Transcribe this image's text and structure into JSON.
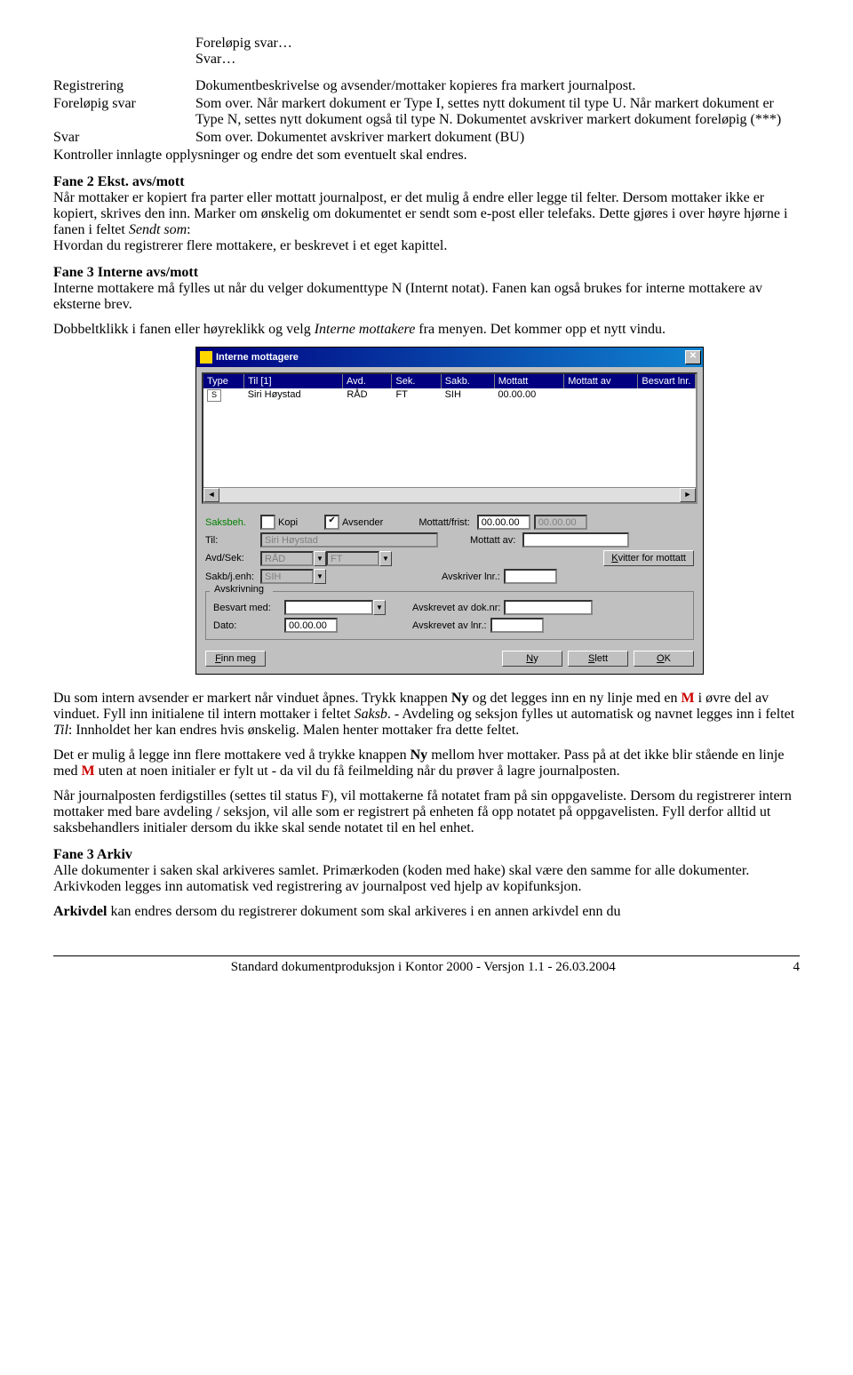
{
  "intro_items": [
    "Foreløpig svar…",
    "Svar…"
  ],
  "defs": [
    {
      "term": "Registrering",
      "desc": "Dokumentbeskrivelse og avsender/mottaker kopieres fra markert journalpost."
    },
    {
      "term": "Foreløpig svar",
      "desc": "Som over. Når markert dokument er Type I, settes nytt dokument til type U. Når markert dokument er Type N, settes nytt dokument også til type N. Dokumentet avskriver markert dokument foreløpig (***)"
    },
    {
      "term": "Svar",
      "desc": "Som over. Dokumentet avskriver markert dokument (BU)"
    }
  ],
  "para1": "Kontroller innlagte opplysninger og endre det som eventuelt skal endres.",
  "fane2": {
    "heading": "Fane 2 Ekst. avs/mott",
    "body_a": "Når mottaker er kopiert fra parter eller mottatt journalpost, er det mulig å endre eller legge til felter. Dersom mottaker ikke er kopiert, skrives den inn. Marker om ønskelig om dokumentet er sendt som e-post eller telefaks. Dette gjøres i over høyre hjørne i fanen i feltet ",
    "body_italic": "Sendt som",
    "body_b": ":",
    "body_c": "Hvordan du registrerer flere mottakere, er beskrevet i et eget kapittel."
  },
  "fane3int": {
    "heading": "Fane 3 Interne avs/mott",
    "line1": "Interne mottakere må fylles ut når du velger dokumenttype N (Internt notat). Fanen kan også brukes for interne mottakere av eksterne brev.",
    "line2a": "Dobbeltklikk i fanen eller høyreklikk og velg ",
    "line2_italic": "Interne mottakere",
    "line2b": " fra menyen. Det kommer opp et nytt vindu."
  },
  "dialog": {
    "title": "Interne mottagere",
    "headers": {
      "type": "Type",
      "til": "Til [1]",
      "avd": "Avd.",
      "sek": "Sek.",
      "sakb": "Sakb.",
      "mottatt": "Mottatt",
      "mottattav": "Mottatt av",
      "besvart": "Besvart lnr."
    },
    "row": {
      "type": "S",
      "til": "Siri Høystad",
      "avd": "RÅD",
      "sek": "FT",
      "sakb": "SIH",
      "mottatt": "00.00.00",
      "mottattav": "",
      "besvart": ""
    },
    "form": {
      "saksbeh": "Saksbeh.",
      "kopi": "Kopi",
      "avsender": "Avsender",
      "mottatt_frist": "Mottatt/frist:",
      "til": "Til:",
      "til_val": "Siri Høystad",
      "mottatt_av": "Mottatt av:",
      "avdsek": "Avd/Sek:",
      "avd_val": "RÅD",
      "sek_val": "FT",
      "kvitter": "Kvitter for mottatt",
      "sakbj": "Sakb/j.enh:",
      "sakbj_val": "SIH",
      "avskriverlnr": "Avskriver lnr.:",
      "group": "Avskrivning",
      "besvart_med": "Besvart med:",
      "avskrevet_dok": "Avskrevet av dok.nr:",
      "dato": "Dato:",
      "dato_val": "00.00.00",
      "avskrevet_lnr": "Avskrevet av lnr.:",
      "date_00": "00.00.00"
    },
    "buttons": {
      "finn": "Finn meg",
      "ny": "Ny",
      "slett": "Slett",
      "ok": "OK"
    }
  },
  "after_dialog": {
    "p1_a": "Du som intern avsender er markert når vinduet åpnes. Trykk knappen ",
    "p1_b": "Ny",
    "p1_c": " og det legges inn en ny linje med en ",
    "p1_m": "M",
    "p1_d": " i øvre del av vinduet. Fyll inn initialene til intern mottaker i feltet ",
    "p1_italic1": "Saksb",
    "p1_e": ". - Avdeling og seksjon fylles ut automatisk og navnet legges inn i feltet ",
    "p1_italic2": "Til",
    "p1_f": ":  Innholdet her kan endres hvis ønskelig. Malen henter mottaker fra dette feltet.",
    "p2_a": "Det er mulig å legge inn flere mottakere ved å trykke knappen ",
    "p2_b": "Ny",
    "p2_c": " mellom hver mottaker. Pass på at det ikke blir stående en linje med ",
    "p2_m": "M",
    "p2_d": " uten at noen initialer er fylt ut - da vil du få feilmelding når du prøver å lagre journalposten.",
    "p3": "Når journalposten ferdigstilles (settes til status F), vil mottakerne få notatet fram på sin oppgaveliste. Dersom du registrerer intern mottaker med bare avdeling / seksjon, vil alle som er registrert på enheten få opp notatet på oppgavelisten. Fyll derfor alltid ut saksbehandlers initialer dersom du ikke skal sende notatet til en hel enhet."
  },
  "fane3arkiv": {
    "heading": "Fane 3 Arkiv",
    "p1": "Alle dokumenter i saken skal arkiveres samlet. Primærkoden (koden med hake) skal være den samme for alle dokumenter. Arkivkoden legges inn automatisk ved registrering av journalpost ved hjelp av kopifunksjon.",
    "p2_a": "Arkivdel",
    "p2_b": " kan endres dersom du registrerer dokument som skal arkiveres i en annen arkivdel enn du"
  },
  "footer": {
    "text": "Standard dokumentproduksjon i Kontor 2000  -  Versjon 1.1  -  26.03.2004",
    "page": "4"
  }
}
